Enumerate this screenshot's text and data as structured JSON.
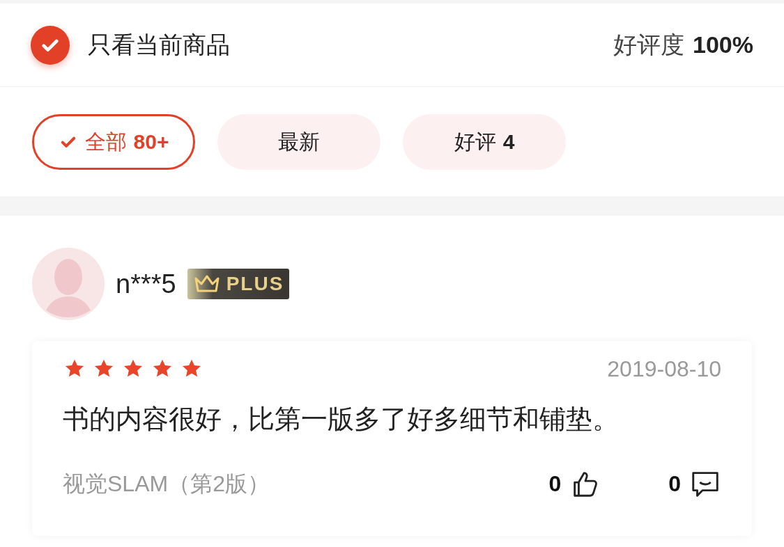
{
  "header": {
    "only_current": {
      "label": "只看当前商品",
      "checked": true
    },
    "rating": {
      "label": "好评度",
      "value": "100%"
    }
  },
  "filters": [
    {
      "label": "全部",
      "count": "80+",
      "selected": true
    },
    {
      "label": "最新",
      "selected": false
    },
    {
      "label": "好评",
      "count": "4",
      "selected": false
    }
  ],
  "reviews": [
    {
      "user": "n***5",
      "badge": "PLUS",
      "stars": 5,
      "date": "2019-08-10",
      "text": "书的内容很好，比第一版多了好多细节和铺垫。",
      "product": "视觉SLAM（第2版）",
      "likes": "0",
      "comments": "0"
    }
  ]
}
